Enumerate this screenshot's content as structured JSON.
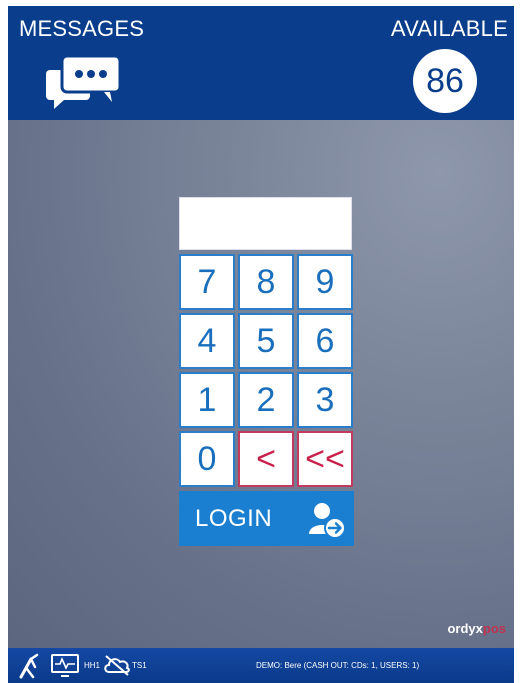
{
  "header": {
    "messages_label": "MESSAGES",
    "available_label": "AVAILABLE",
    "available_count": "86",
    "message_icon": "chat-bubbles-icon"
  },
  "keypad": {
    "rows": [
      [
        "7",
        "8",
        "9"
      ],
      [
        "4",
        "5",
        "6"
      ],
      [
        "1",
        "2",
        "3"
      ]
    ],
    "zero": "0",
    "backspace": "<",
    "clear": "<<"
  },
  "login": {
    "label": "LOGIN",
    "icon": "user-arrow-icon"
  },
  "brand": {
    "name": "ordyx",
    "accent": "pos"
  },
  "footer": {
    "hh_label": "HH1",
    "ts_label": "TS1",
    "status": "DEMO: Bere (CASH OUT: CDs: 1, USERS: 1)"
  },
  "colors": {
    "header_bg": "#0a3d8c",
    "key_border": "#2a7ec9",
    "back_key": "#c8204a",
    "login_bg": "#1a7fd1"
  }
}
